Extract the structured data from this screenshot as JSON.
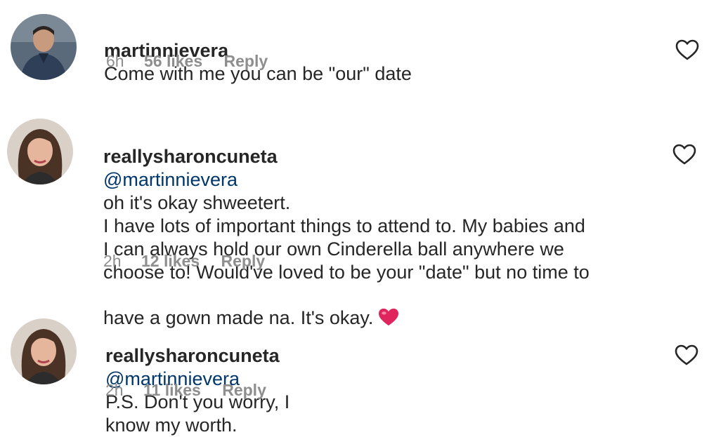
{
  "comments": [
    {
      "username": "martinnievera",
      "mention": "",
      "text": "Come with me you can be \"our\" date",
      "time": "6h",
      "likes": "56 likes",
      "reply": "Reply"
    },
    {
      "username": "reallysharoncuneta",
      "mention": "@martinnievera",
      "text": "oh it's okay shweetert.\nI have lots of important things to attend to. My babies and\nI can always hold our own Cinderella ball anywhere we\nchoose to! Would've loved to be your \"date\" but no time to\nhave a gown made na. It's okay.",
      "emoji": "red-heart-emoji",
      "time": "2h",
      "likes": "12 likes",
      "reply": "Reply"
    },
    {
      "username": "reallysharoncuneta",
      "mention": "@martinnievera",
      "text": "P.S. Don't you worry, I\nknow my worth.",
      "time": "2h",
      "likes": "11 likes",
      "reply": "Reply"
    }
  ],
  "colors": {
    "text": "#262626",
    "secondary": "#8e8e8e",
    "mention": "#00376b",
    "heart_emoji": "#e0245e"
  },
  "icons": {
    "like": "heart-outline-icon"
  }
}
